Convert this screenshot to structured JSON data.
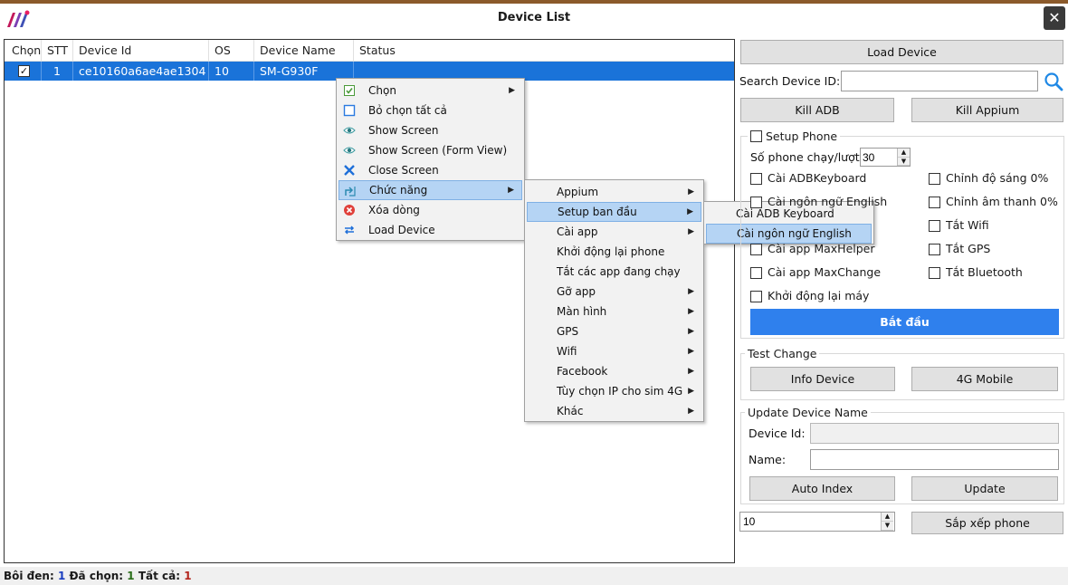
{
  "window": {
    "title": "Device List",
    "close_glyph": "✕"
  },
  "grid": {
    "columns": [
      "Chọn",
      "STT",
      "Device Id",
      "OS",
      "Device Name",
      "Status"
    ],
    "rows": [
      {
        "checked": true,
        "stt": "1",
        "device_id": "ce10160a6ae4ae1304",
        "os": "10",
        "device_name": "SM-G930F",
        "status": ""
      }
    ]
  },
  "context_menu": {
    "items": [
      {
        "label": "Chọn",
        "icon": "checkbox-checked-icon",
        "submenu": true
      },
      {
        "label": "Bỏ chọn tất cả",
        "icon": "checkbox-empty-icon",
        "submenu": false
      },
      {
        "label": "Show Screen",
        "icon": "eye-icon",
        "submenu": false
      },
      {
        "label": "Show Screen (Form View)",
        "icon": "eye-icon",
        "submenu": false
      },
      {
        "label": "Close Screen",
        "icon": "close-x-icon",
        "submenu": false
      },
      {
        "label": "Chức năng",
        "icon": "function-icon",
        "submenu": true,
        "selected": true
      },
      {
        "label": "Xóa dòng",
        "icon": "delete-icon",
        "submenu": false
      },
      {
        "label": "Load Device",
        "icon": "reload-icon",
        "submenu": false
      }
    ]
  },
  "function_menu": {
    "items": [
      {
        "label": "Appium",
        "submenu": true
      },
      {
        "label": "Setup ban đầu",
        "submenu": true,
        "selected": true
      },
      {
        "label": "Cài app",
        "submenu": true
      },
      {
        "label": "Khởi động lại phone",
        "submenu": false
      },
      {
        "label": "Tắt các app đang chạy",
        "submenu": false
      },
      {
        "label": "Gỡ app",
        "submenu": true
      },
      {
        "label": "Màn hình",
        "submenu": true
      },
      {
        "label": "GPS",
        "submenu": true
      },
      {
        "label": "Wifi",
        "submenu": true
      },
      {
        "label": "Facebook",
        "submenu": true
      },
      {
        "label": "Tùy chọn IP cho sim 4G",
        "submenu": true
      },
      {
        "label": "Khác",
        "submenu": true
      }
    ]
  },
  "setup_menu": {
    "items": [
      {
        "label": "Cài ADB Keyboard",
        "selected": false
      },
      {
        "label": "Cài ngôn ngữ English",
        "selected": true
      }
    ]
  },
  "right_panel": {
    "load_device": "Load Device",
    "search_label": "Search Device ID:",
    "search_value": "",
    "kill_adb": "Kill ADB",
    "kill_appium": "Kill Appium",
    "setup_phone": {
      "title": "Setup Phone",
      "count_label": "Số phone chạy/lượt:",
      "count_value": "30",
      "left_options": [
        "Cài ADBKeyboard",
        "Cài ngôn ngữ English",
        "",
        "Cài app MaxHelper",
        "Cài app MaxChange",
        "Khởi động lại máy"
      ],
      "right_options": [
        "Chỉnh độ sáng 0%",
        "Chỉnh âm thanh 0%",
        "Tắt Wifi",
        "Tắt GPS",
        "Tắt Bluetooth"
      ],
      "start": "Bắt đầu"
    },
    "test_change": {
      "title": "Test Change",
      "info_device": "Info Device",
      "mobile_4g": "4G Mobile"
    },
    "update_name": {
      "title": "Update Device Name",
      "device_id_label": "Device Id:",
      "device_id_value": "",
      "name_label": "Name:",
      "name_value": "",
      "auto_index": "Auto Index",
      "update": "Update"
    },
    "sort_value": "10",
    "sort_button": "Sắp xếp phone"
  },
  "status": {
    "highlight_label": "Bôi đen:",
    "highlight_value": "1",
    "selected_label": "Đã chọn:",
    "selected_value": "1",
    "total_label": "Tất cả:",
    "total_value": "1"
  },
  "colors": {
    "accent": "#2f80ed",
    "row_selected": "#1a73d9",
    "menu_highlight": "#b5d4f4"
  }
}
